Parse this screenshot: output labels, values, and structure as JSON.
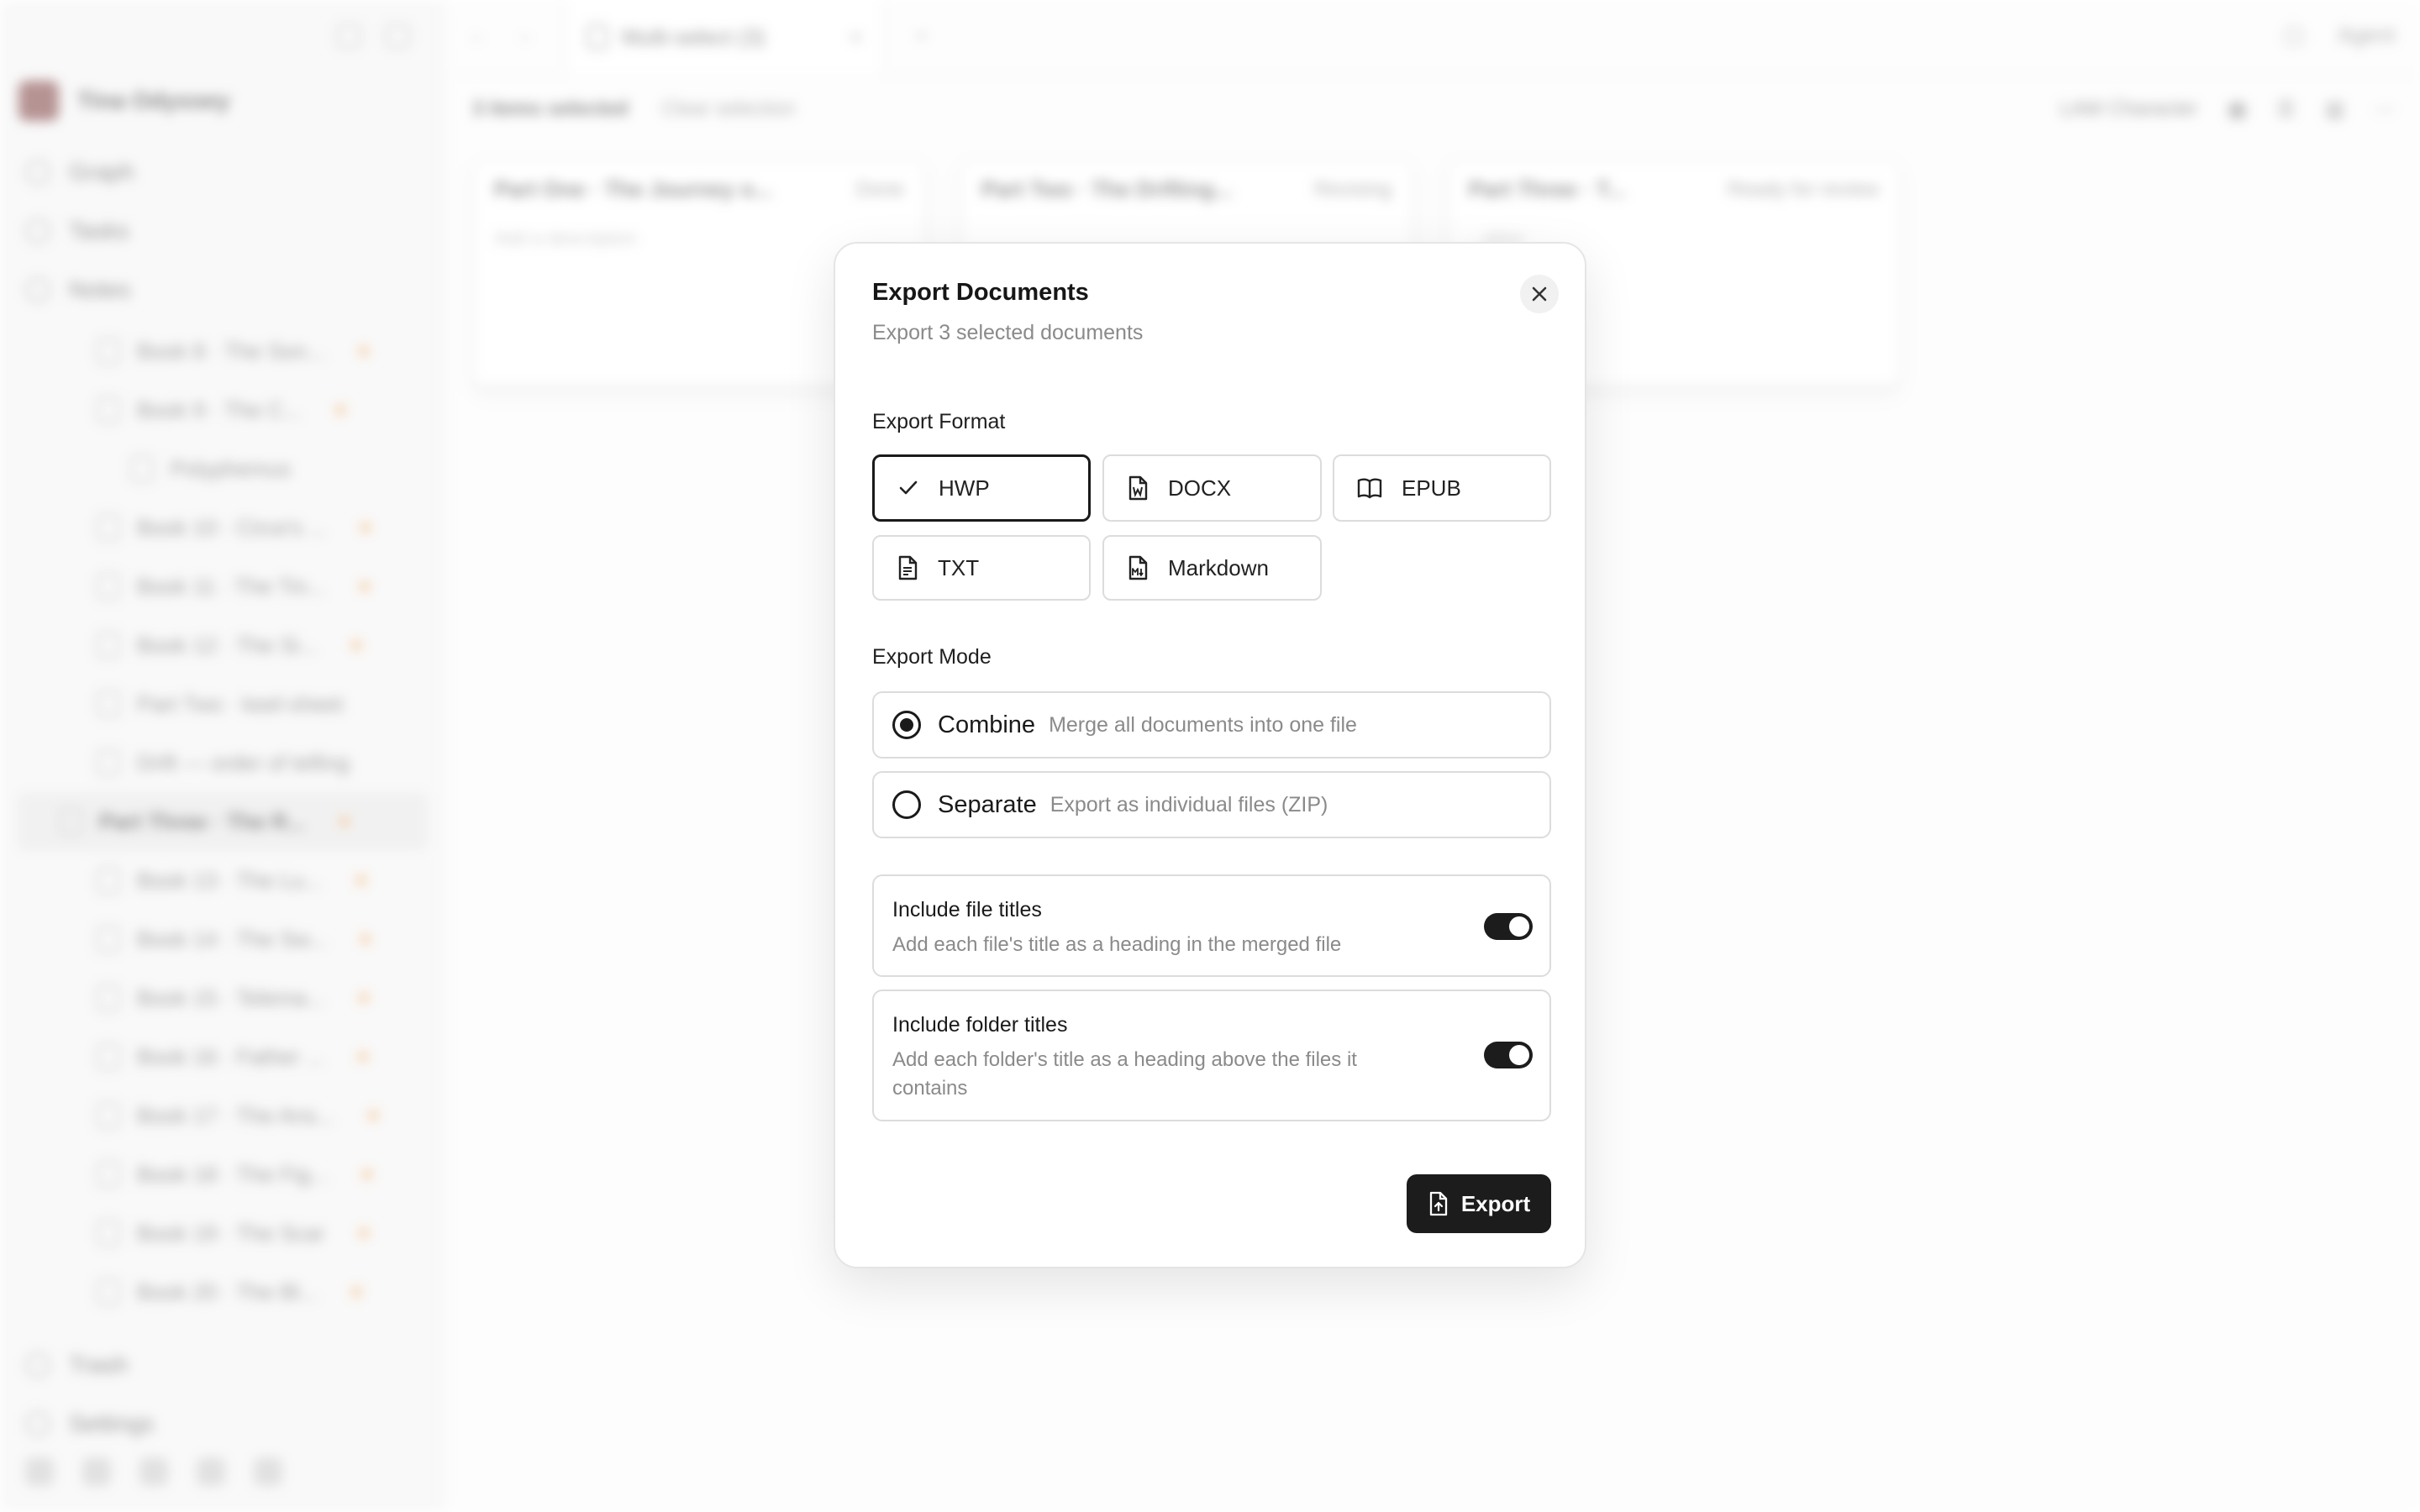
{
  "background": {
    "user_name": "Tina Odyssey",
    "nav": [
      {
        "label": "Graph"
      },
      {
        "label": "Tasks"
      },
      {
        "label": "Notes"
      }
    ],
    "tree": [
      {
        "label": "Book 8 · The Son..."
      },
      {
        "label": "Book 9 · The C..."
      },
      {
        "label": "Polyphemus"
      },
      {
        "label": "Book 10 · Circe's ..."
      },
      {
        "label": "Book 11 · The Tin..."
      },
      {
        "label": "Book 12 · The Si..."
      },
      {
        "label": "Part Two · keel-sheet"
      },
      {
        "label": "Drift — order of telling"
      },
      {
        "label": "Part Three · The R..."
      },
      {
        "label": "Book 13 · The Lu..."
      },
      {
        "label": "Book 14 · The Sw..."
      },
      {
        "label": "Book 15 · Telema..."
      },
      {
        "label": "Book 16 · Father ..."
      },
      {
        "label": "Book 17 · The Ans..."
      },
      {
        "label": "Book 18 · The Fig..."
      },
      {
        "label": "Book 19 · The Scar"
      },
      {
        "label": "Book 20 · The Bl..."
      }
    ],
    "bottom_nav": [
      {
        "label": "Trash"
      },
      {
        "label": "Settings"
      }
    ],
    "tab_title": "Multi-select (3)",
    "agent_label": "Agent",
    "toolbar": {
      "selected": "3 items selected",
      "clear": "Clear selection",
      "view": "LAW Character"
    },
    "cards": [
      {
        "title": "Part One · The Journey o...",
        "status": "Done",
        "desc": "Add a description"
      },
      {
        "title": "Part Two · The Drifting...",
        "status": "Revising",
        "desc": ""
      },
      {
        "title": "Part Three · T...",
        "status": "Ready for review",
        "desc": "...ption"
      }
    ]
  },
  "modal": {
    "title": "Export Documents",
    "subtitle": "Export 3 selected documents",
    "format_label": "Export Format",
    "formats": [
      {
        "label": "HWP",
        "icon": "check-icon",
        "selected": true
      },
      {
        "label": "DOCX",
        "icon": "word-file-icon",
        "selected": false
      },
      {
        "label": "EPUB",
        "icon": "book-open-icon",
        "selected": false
      },
      {
        "label": "TXT",
        "icon": "text-file-icon",
        "selected": false
      },
      {
        "label": "Markdown",
        "icon": "markdown-file-icon",
        "selected": false
      }
    ],
    "mode_label": "Export Mode",
    "modes": [
      {
        "label": "Combine",
        "desc": "Merge all documents into one file",
        "selected": true
      },
      {
        "label": "Separate",
        "desc": "Export as individual files (ZIP)",
        "selected": false
      }
    ],
    "options": [
      {
        "title": "Include file titles",
        "desc": "Add each file's title as a heading in the merged file",
        "enabled": true
      },
      {
        "title": "Include folder titles",
        "desc": "Add each folder's title as a heading above the files it contains",
        "enabled": true
      }
    ],
    "export_button": "Export"
  }
}
